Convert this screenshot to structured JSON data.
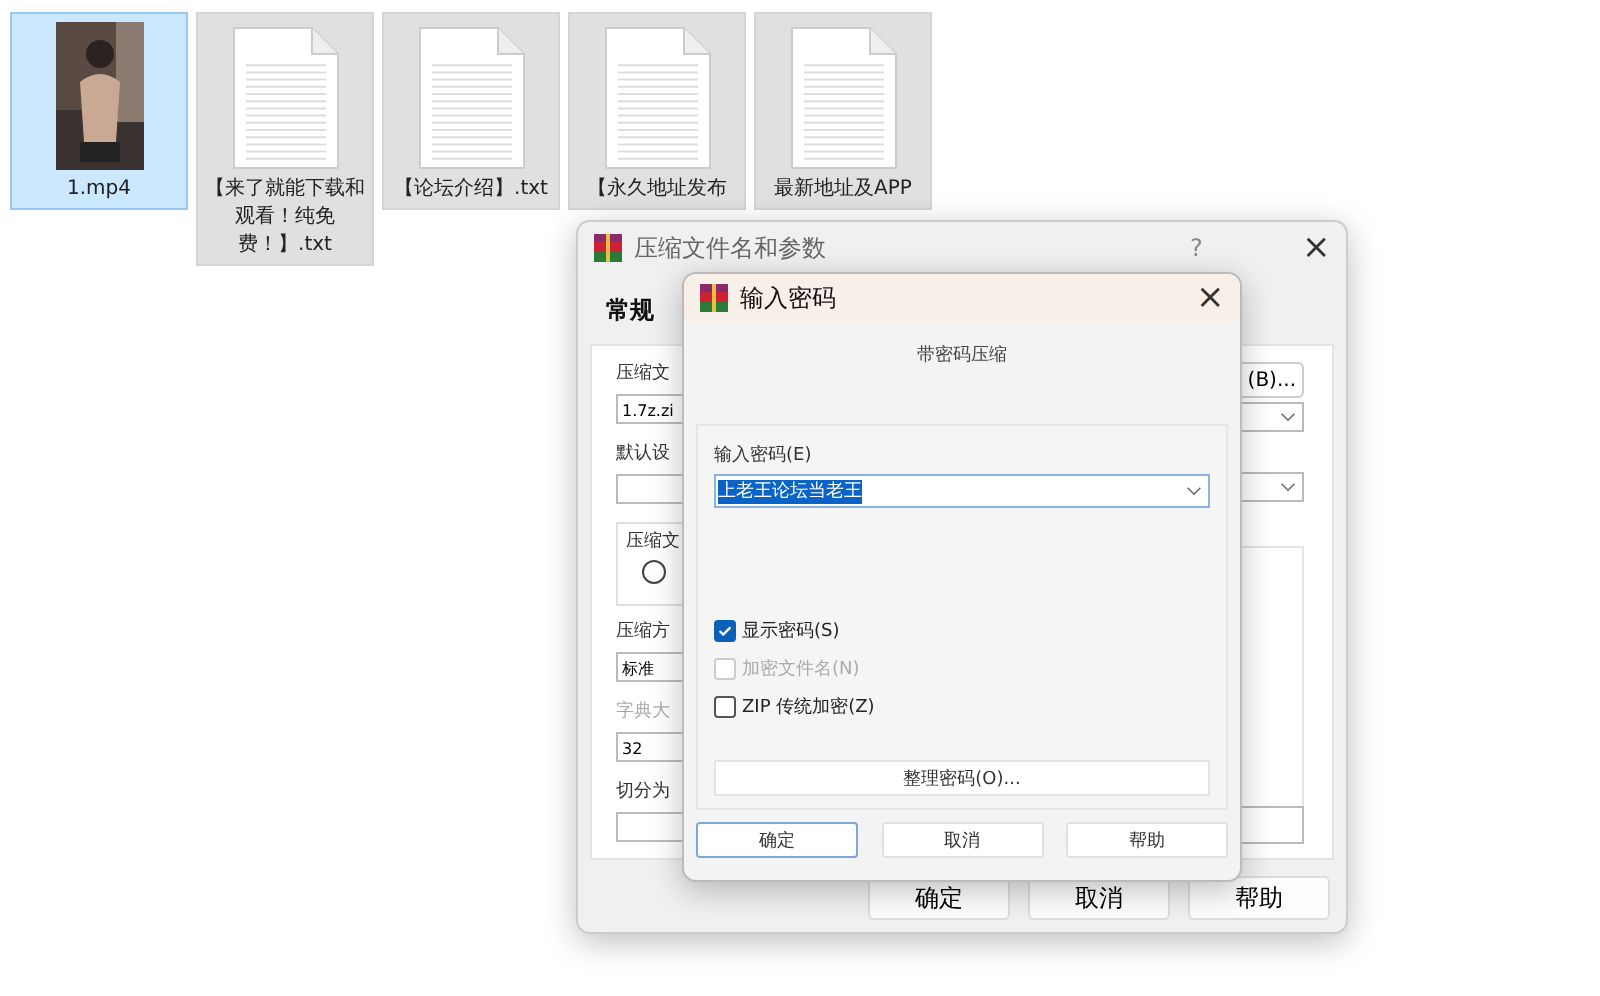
{
  "desktop_files": [
    {
      "name": "1.mp4",
      "kind": "video",
      "selected": true
    },
    {
      "name": "【来了就能下载和观看！纯免费！】.txt",
      "kind": "text",
      "selected": false
    },
    {
      "name": "【论坛介绍】.txt",
      "kind": "text",
      "selected": false
    },
    {
      "name": "【永久地址发布",
      "kind": "text",
      "selected": false
    },
    {
      "name": "最新地址及APP",
      "kind": "text",
      "selected": false
    }
  ],
  "archive_dialog": {
    "title": "压缩文件名和参数",
    "help": "?",
    "close": "×",
    "tab": {
      "label": "常规",
      "selected": true
    },
    "left_fields": [
      {
        "kind": "label",
        "text": "压缩文"
      },
      {
        "kind": "input",
        "text": "1.7z.zi"
      },
      {
        "kind": "label",
        "text": "默认设"
      },
      {
        "kind": "input"
      },
      {
        "kind": "group",
        "text": "压缩文",
        "radio_selected": false
      },
      {
        "kind": "label",
        "text": "压缩方"
      },
      {
        "kind": "select",
        "text": "标准"
      },
      {
        "kind": "dimmed_label",
        "text": "字典大"
      },
      {
        "kind": "input",
        "text": "32"
      },
      {
        "kind": "label",
        "text": "切分为"
      },
      {
        "kind": "input"
      }
    ],
    "browse_button": "(B)...",
    "buttons": [
      "确定",
      "取消",
      "帮助"
    ]
  },
  "password_dialog": {
    "title": "输入密码",
    "close": "×",
    "subtitle": "带密码压缩",
    "password_label": "输入密码(E)",
    "password": "上老王论坛当老王",
    "options": [
      {
        "label": "显示密码(S)",
        "checked": true,
        "disabled": false
      },
      {
        "label": "加密文件名(N)",
        "checked": false,
        "disabled": true
      },
      {
        "label": "ZIP 传统加密(Z)",
        "checked": false,
        "disabled": false
      }
    ],
    "organize_button": "整理密码(O)...",
    "buttons": [
      {
        "label": "确定",
        "default": true
      },
      {
        "label": "取消",
        "default": false
      },
      {
        "label": "帮助",
        "default": false
      }
    ]
  }
}
